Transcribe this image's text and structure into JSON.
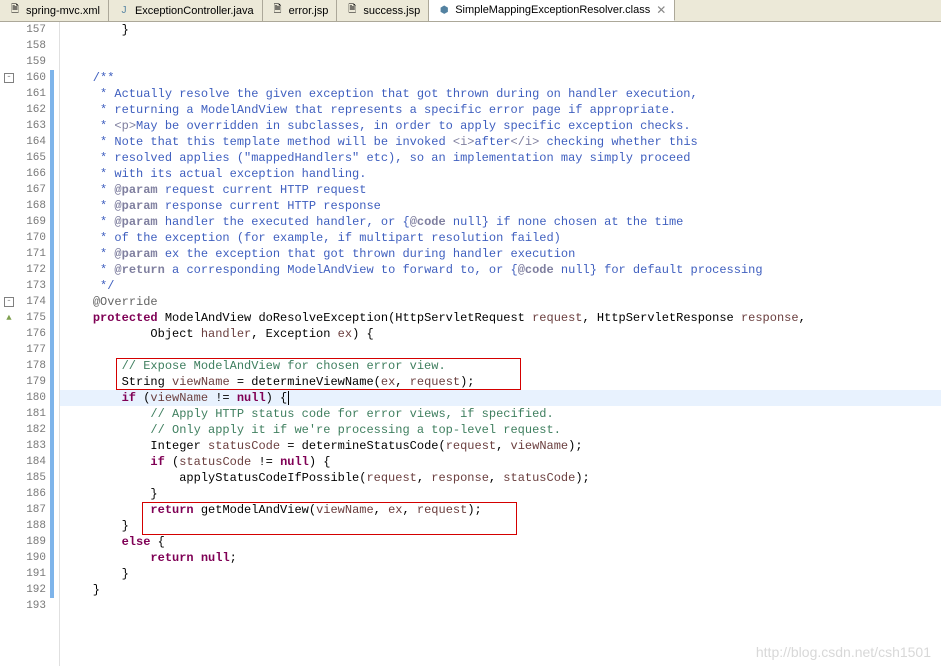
{
  "tabs": [
    {
      "label": "spring-mvc.xml",
      "icon": "xml",
      "active": false
    },
    {
      "label": "ExceptionController.java",
      "icon": "java",
      "active": false
    },
    {
      "label": "error.jsp",
      "icon": "jsp",
      "active": false
    },
    {
      "label": "success.jsp",
      "icon": "jsp",
      "active": false
    },
    {
      "label": "SimpleMappingExceptionResolver.class",
      "icon": "class",
      "active": true
    }
  ],
  "code": {
    "l157": "        }",
    "l160": "    /**",
    "l161_a": "     * Actually resolve the given exception that got thrown during on handler execution,",
    "l162_a": "     * returning a ModelAndView that represents a specific error page if appropriate.",
    "l163_a": "     * ",
    "l163_b": "<p>",
    "l163_c": "May be overridden in subclasses, in order to apply specific exception checks.",
    "l164_a": "     * Note that this template method will be invoked ",
    "l164_b": "<i>",
    "l164_c": "after",
    "l164_d": "</i>",
    "l164_e": " checking whether this",
    "l165_a": "     * resolved applies (\"mappedHandlers\" etc), so an implementation may simply proceed",
    "l166_a": "     * with its actual exception handling.",
    "l167_a": "     * ",
    "l167_b": "@param",
    "l167_c": " request current HTTP request",
    "l168_a": "     * ",
    "l168_b": "@param",
    "l168_c": " response current HTTP response",
    "l169_a": "     * ",
    "l169_b": "@param",
    "l169_c": " handler the executed handler, or {",
    "l169_d": "@code",
    "l169_e": " null} if none chosen at the time",
    "l170_a": "     * of the exception (for example, if multipart resolution failed)",
    "l171_a": "     * ",
    "l171_b": "@param",
    "l171_c": " ex the exception that got thrown during handler execution",
    "l172_a": "     * ",
    "l172_b": "@return",
    "l172_c": " a corresponding ModelAndView to forward to, or {",
    "l172_d": "@code",
    "l172_e": " null} for default processing",
    "l173": "     */",
    "l174": "@Override",
    "l175_a": "protected",
    "l175_b": " ModelAndView doResolveException(HttpServletRequest ",
    "l175_c": "request",
    "l175_d": ", HttpServletResponse ",
    "l175_e": "response",
    "l175_f": ",",
    "l176_a": "            Object ",
    "l176_b": "handler",
    "l176_c": ", Exception ",
    "l176_d": "ex",
    "l176_e": ") {",
    "l178": "// Expose ModelAndView for chosen error view.",
    "l179_a": "        String ",
    "l179_b": "viewName",
    "l179_c": " = determineViewName(",
    "l179_d": "ex",
    "l179_e": ", ",
    "l179_f": "request",
    "l179_g": ");",
    "l180_a": "if",
    "l180_b": " (",
    "l180_c": "viewName",
    "l180_d": " != ",
    "l180_e": "null",
    "l180_f": ") {",
    "l181": "// Apply HTTP status code for error views, if specified.",
    "l182": "// Only apply it if we're processing a top-level request.",
    "l183_a": "            Integer ",
    "l183_b": "statusCode",
    "l183_c": " = determineStatusCode(",
    "l183_d": "request",
    "l183_e": ", ",
    "l183_f": "viewName",
    "l183_g": ");",
    "l184_a": "if",
    "l184_b": " (",
    "l184_c": "statusCode",
    "l184_d": " != ",
    "l184_e": "null",
    "l184_f": ") {",
    "l185_a": "                applyStatusCodeIfPossible(",
    "l185_b": "request",
    "l185_c": ", ",
    "l185_d": "response",
    "l185_e": ", ",
    "l185_f": "statusCode",
    "l185_g": ");",
    "l186": "            }",
    "l187_a": "return",
    "l187_b": " getModelAndView(",
    "l187_c": "viewName",
    "l187_d": ", ",
    "l187_e": "ex",
    "l187_f": ", ",
    "l187_g": "request",
    "l187_h": ");",
    "l188": "        }",
    "l189_a": "else",
    "l189_b": " {",
    "l190_a": "return",
    "l190_b": " null",
    "l190_c": ";",
    "l191": "        }",
    "l192": "    }"
  },
  "watermark": "http://blog.csdn.net/csh1501"
}
